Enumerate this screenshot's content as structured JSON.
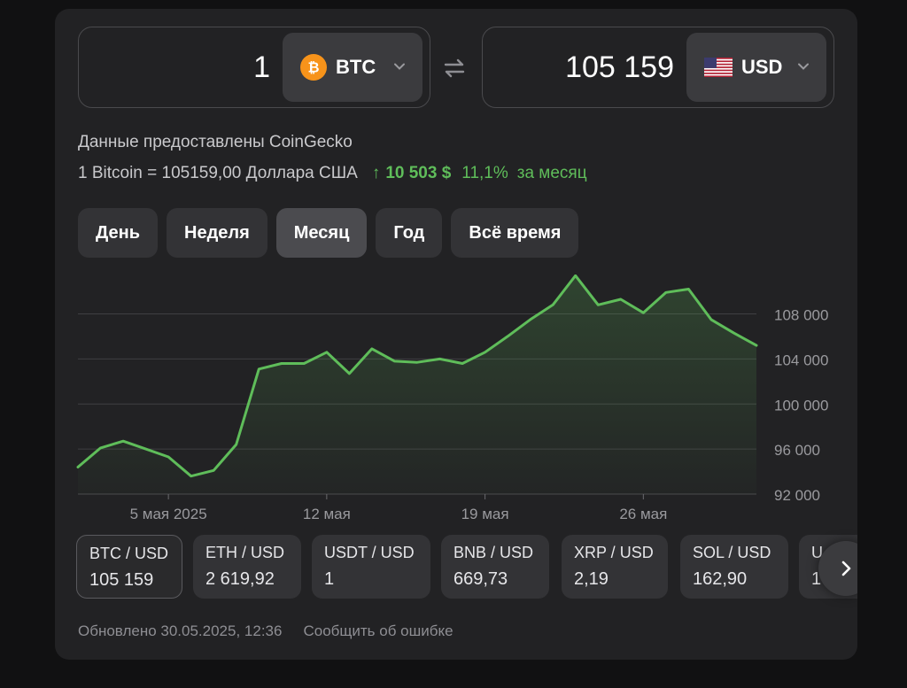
{
  "converter": {
    "from_amount": "1",
    "from_currency": "BTC",
    "to_amount": "105 159",
    "to_currency": "USD"
  },
  "provider_text": "Данные предоставлены CoinGecko",
  "rate": {
    "text": "1 Bitcoin = 105159,00 Доллара США",
    "change_arrow": "↑",
    "change_value": "10 503 $",
    "change_pct": "11,1%",
    "change_period": "за месяц"
  },
  "tabs": [
    {
      "label": "День"
    },
    {
      "label": "Неделя"
    },
    {
      "label": "Месяц",
      "active": true
    },
    {
      "label": "Год"
    },
    {
      "label": "Всё время"
    }
  ],
  "chart_data": {
    "type": "area",
    "x": [
      "2025-05-01",
      "2025-05-02",
      "2025-05-03",
      "2025-05-04",
      "2025-05-05",
      "2025-05-06",
      "2025-05-07",
      "2025-05-08",
      "2025-05-09",
      "2025-05-10",
      "2025-05-11",
      "2025-05-12",
      "2025-05-13",
      "2025-05-14",
      "2025-05-15",
      "2025-05-16",
      "2025-05-17",
      "2025-05-18",
      "2025-05-19",
      "2025-05-20",
      "2025-05-21",
      "2025-05-22",
      "2025-05-23",
      "2025-05-24",
      "2025-05-25",
      "2025-05-26",
      "2025-05-27",
      "2025-05-28",
      "2025-05-29",
      "2025-05-30"
    ],
    "y": [
      94400,
      96100,
      96700,
      96000,
      95300,
      93600,
      94100,
      96400,
      103100,
      103600,
      103600,
      104600,
      102700,
      104900,
      103800,
      103700,
      104000,
      103600,
      104600,
      106000,
      107500,
      108800,
      111400,
      108800,
      109300,
      108100,
      109900,
      110200,
      107500,
      106300,
      105200
    ],
    "x_ticks": [
      "5 мая 2025",
      "12 мая",
      "19 мая",
      "26 мая"
    ],
    "y_ticks": [
      "108 000",
      "104 000",
      "100 000",
      "96 000",
      "92 000"
    ],
    "ylim": [
      92000,
      111500
    ],
    "grid": true,
    "line_color": "#5fbd5a"
  },
  "tickers": [
    {
      "pair": "BTC / USD",
      "value": "105 159"
    },
    {
      "pair": "ETH / USD",
      "value": "2 619,92"
    },
    {
      "pair": "USDT / USD",
      "value": "1"
    },
    {
      "pair": "BNB / USD",
      "value": "669,73"
    },
    {
      "pair": "XRP / USD",
      "value": "2,19"
    },
    {
      "pair": "SOL / USD",
      "value": "162,90"
    },
    {
      "pair": "U",
      "value": "1"
    }
  ],
  "footer": {
    "updated": "Обновлено 30.05.2025, 12:36",
    "report": "Сообщить об ошибке"
  },
  "colors": {
    "accent_green": "#5fbd5a",
    "bitcoin_orange": "#f7931a"
  }
}
